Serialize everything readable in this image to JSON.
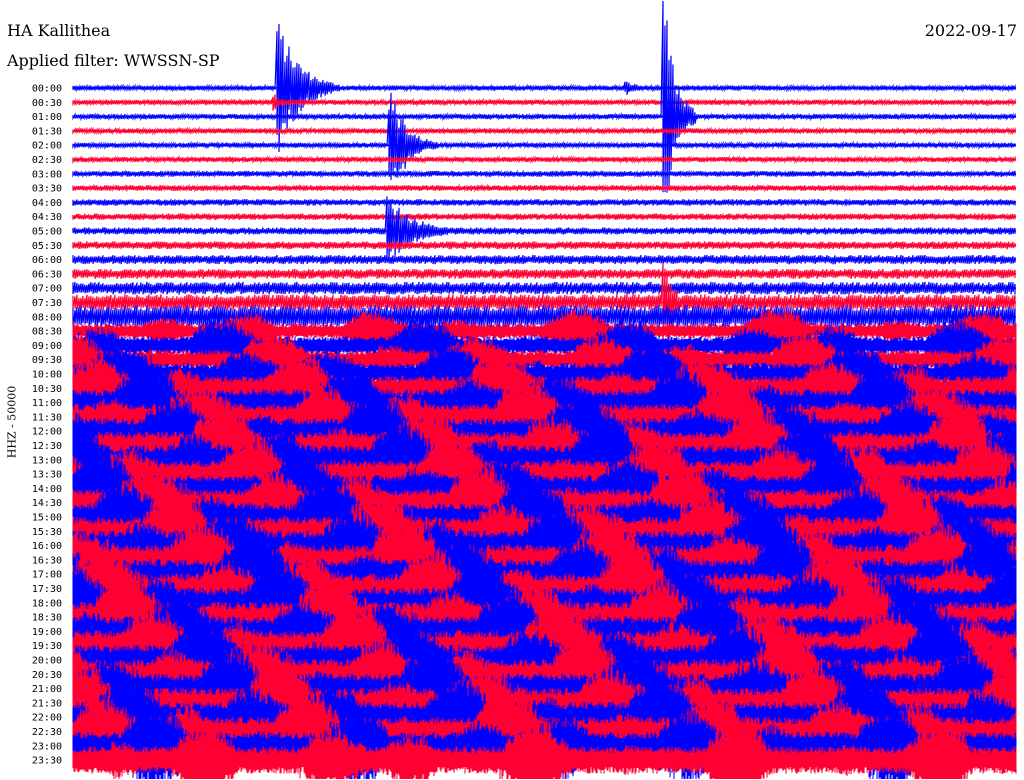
{
  "header": {
    "station": "HA Kallithea",
    "filter": "Applied filter: WWSSN-SP",
    "date": "2022-09-17"
  },
  "chart_data": {
    "type": "line",
    "title": "HA Kallithea",
    "subtitle": "Applied filter: WWSSN-SP",
    "date": "2022-09-17",
    "ylabel": "HHZ - 50000",
    "row_times": [
      "00:00",
      "00:30",
      "01:00",
      "01:30",
      "02:00",
      "02:30",
      "03:00",
      "03:30",
      "04:00",
      "04:30",
      "05:00",
      "05:30",
      "06:00",
      "06:30",
      "07:00",
      "07:30",
      "08:00",
      "08:30",
      "09:00",
      "09:30",
      "10:00",
      "10:30",
      "11:00",
      "11:30",
      "12:00",
      "12:30",
      "13:00",
      "13:30",
      "14:00",
      "14:30",
      "15:00",
      "15:30",
      "16:00",
      "16:30",
      "17:00",
      "17:30",
      "18:00",
      "18:30",
      "19:00",
      "19:30",
      "20:00",
      "20:30",
      "21:00",
      "21:30",
      "22:00",
      "22:30",
      "23:00",
      "23:30"
    ],
    "row_colors": [
      "#0000ff",
      "#ff0033"
    ],
    "noise_level": [
      0.03,
      0.03,
      0.03,
      0.03,
      0.03,
      0.03,
      0.04,
      0.04,
      0.05,
      0.05,
      0.06,
      0.07,
      0.09,
      0.1,
      0.14,
      0.2,
      0.3,
      0.45,
      0.55,
      0.6,
      0.7,
      0.8,
      0.85,
      0.85,
      0.85,
      0.9,
      0.95,
      0.9,
      0.85,
      0.9,
      0.9,
      0.95,
      1.0,
      1.0,
      1.0,
      1.0,
      1.0,
      1.0,
      1.0,
      1.0,
      1.0,
      1.0,
      1.0,
      1.0,
      1.0,
      0.95,
      0.9,
      0.9
    ],
    "events": [
      {
        "row": 0,
        "minute": 6.5,
        "amplitude": 5,
        "duration": 2
      },
      {
        "row": 1,
        "minute": 6.4,
        "amplitude": 0.6,
        "duration": 1
      },
      {
        "row": 0,
        "minute": 17.6,
        "amplitude": 0.5,
        "duration": 1.5
      },
      {
        "row": 4,
        "minute": 10.1,
        "amplitude": 4,
        "duration": 1.5
      },
      {
        "row": 10,
        "minute": 10.0,
        "amplitude": 2.5,
        "duration": 2.5
      },
      {
        "row": 2,
        "minute": 18.8,
        "amplitude": 9,
        "duration": 1
      },
      {
        "row": 15,
        "minute": 18.8,
        "amplitude": 3,
        "duration": 1
      }
    ],
    "x_minutes": 30
  }
}
